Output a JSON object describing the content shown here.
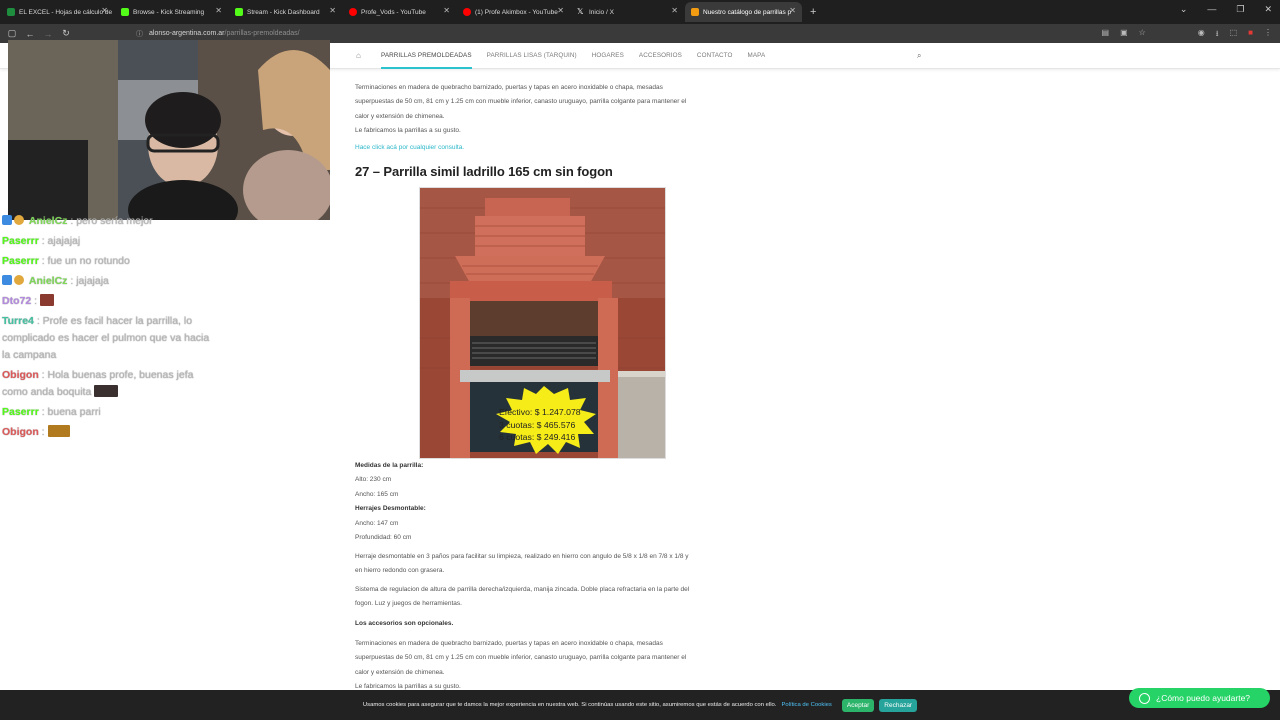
{
  "browser": {
    "tabs": [
      {
        "title": "EL EXCEL - Hojas de cálculo de",
        "color": "#1e8e3e"
      },
      {
        "title": "Browse - Kick Streaming",
        "color": "#53fc18"
      },
      {
        "title": "Stream - Kick Dashboard",
        "color": "#53fc18"
      },
      {
        "title": "Profe_Vods - YouTube",
        "color": "#ff0000"
      },
      {
        "title": "(1) Profe Akimbox - YouTube",
        "color": "#ff0000"
      },
      {
        "title": "Inicio / X",
        "color": "#ffffff"
      },
      {
        "title": "Nuestro catálogo de parrillas p",
        "color": "#f39c12"
      }
    ],
    "new_tab": "+",
    "url_host": "alonso-argentina.com.ar",
    "url_path": "/parrillas-premoldeadas/"
  },
  "site_nav": {
    "items": [
      "PARRILLAS PREMOLDEADAS",
      "PARRILLAS LISAS (TARQUIN)",
      "HOGARES",
      "ACCESORIOS",
      "CONTACTO",
      "MAPA"
    ]
  },
  "article": {
    "cutoff_heading": "Los accesorios son opcionales.",
    "p1_line1": "Terminaciones en madera de quebracho barnizado, puertas y tapas en acero inoxidable o chapa, mesadas",
    "p1_line2": "superpuestas de 50 cm, 81 cm y 1.25 cm con mueble inferior, canasto uruguayo, parrilla colgante para mantener el",
    "p1_line3": "calor y extensión de chimenea.",
    "p1_line4": "Le fabricamos la parrillas a su gusto.",
    "contact_link": "Hace click acá por cualquier consulta.",
    "product_title": "27 – Parrilla simil ladrillo 165 cm sin fogon",
    "price_cash": "Efectivo: $ 1.247.078",
    "price_3": "3 cuotas: $ 465.576",
    "price_6": "6 cuotas: $ 249.416",
    "medidas_label": "Medidas de la parrilla:",
    "alto": "Alto: 230 cm",
    "ancho": "Ancho: 165 cm",
    "herrajes_label": "Herrajes Desmontable:",
    "h_ancho": "Ancho: 147 cm",
    "h_prof": "Profundidad: 60 cm",
    "herraje_desc_1": "Herraje desmontable en 3 paños para facilitar su limpieza, realizado en hierro con angulo de 5/8 x 1/8 en 7/8 x 1/8 y",
    "herraje_desc_2": "en hierro redondo con grasera.",
    "sistema_1": "Sistema de regulacion de altura de parrilla derecha/izquierda, manija zincada. Doble placa refractaria en la parte del",
    "sistema_2": "fogon. Luz y juegos de herramientas.",
    "accesorios_label": "Los accesorios son opcionales.",
    "p2_line1": "Terminaciones en madera de quebracho barnizado, puertas y tapas en acero inoxidable o chapa, mesadas",
    "p2_line2": "superpuestas de 50 cm, 81 cm y 1.25 cm con mueble inferior, canasto uruguayo, parrilla colgante para mantener el",
    "p2_line3": "calor y extensión de chimenea.",
    "p2_line4": "Le fabricamos la parrillas a su gusto."
  },
  "chat": [
    {
      "user": "AnielCz",
      "color": "#7ed957",
      "msg": ": pero sería mejor"
    },
    {
      "user": "Paserrr",
      "color": "#53fc18",
      "msg": ": ajajajaj"
    },
    {
      "user": "Paserrr",
      "color": "#53fc18",
      "msg": ": fue un no rotundo"
    },
    {
      "user": "AnielCz",
      "color": "#7ed957",
      "msg": ": jajajaja"
    },
    {
      "user": "Dto72",
      "color": "#b48be0",
      "msg": ":"
    },
    {
      "user": "Turre4",
      "color": "#43c3a3",
      "msg": ": Profe es facil hacer la parrilla, lo"
    },
    {
      "user": "",
      "color": "#b9b9b9",
      "msg": "complicado es hacer el pulmon que va hacia"
    },
    {
      "user": "",
      "color": "#b9b9b9",
      "msg": "la campana"
    },
    {
      "user": "Obigon",
      "color": "#e05a5a",
      "msg": ": Hola buenas profe, buenas jefa"
    },
    {
      "user": "",
      "color": "#b9b9b9",
      "msg": "como anda boquita"
    },
    {
      "user": "Paserrr",
      "color": "#53fc18",
      "msg": ": buena parri"
    },
    {
      "user": "Obigon",
      "color": "#e05a5a",
      "msg": ":"
    }
  ],
  "cookie": {
    "text": "Usamos cookies para asegurar que te damos la mejor experiencia en nuestra web. Si continúas usando este sitio, asumiremos que estás de acuerdo con ello.",
    "policy": "Política de Cookies",
    "accept": "Aceptar",
    "reject": "Rechazar"
  },
  "whatsapp": {
    "label": "¿Cómo puedo ayudarte?"
  },
  "colors": {
    "accent": "#2bc4ce",
    "whatsapp": "#25d366",
    "kick": "#53fc18"
  }
}
